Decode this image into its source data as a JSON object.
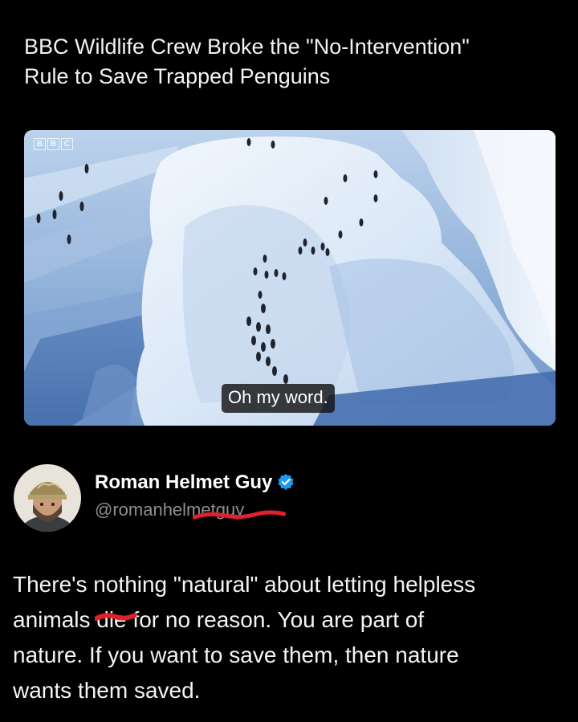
{
  "headline": {
    "line1": "BBC Wildlife Crew Broke the \"No-Intervention\"",
    "line2": "Rule to Save Trapped Penguins"
  },
  "video": {
    "logo_letters": [
      "B",
      "B",
      "C"
    ],
    "subtitle": "Oh my word."
  },
  "tweet": {
    "author_name": "Roman Helmet Guy",
    "verified_icon": "verified-badge-icon",
    "handle": "@romanhelmetguy",
    "text_line1": "There's nothing \"natural\" about letting helpless",
    "text_line2_before": "animals ",
    "text_line2_redacted": "die",
    "text_line2_after": " for no reason. You are part of",
    "text_line3": "nature. If you want to save them, then nature",
    "text_line4": "wants them saved."
  },
  "colors": {
    "background": "#000000",
    "verified_blue": "#1d9bf0",
    "handle_gray": "#8b8f95",
    "redaction_red": "#e0202a"
  }
}
